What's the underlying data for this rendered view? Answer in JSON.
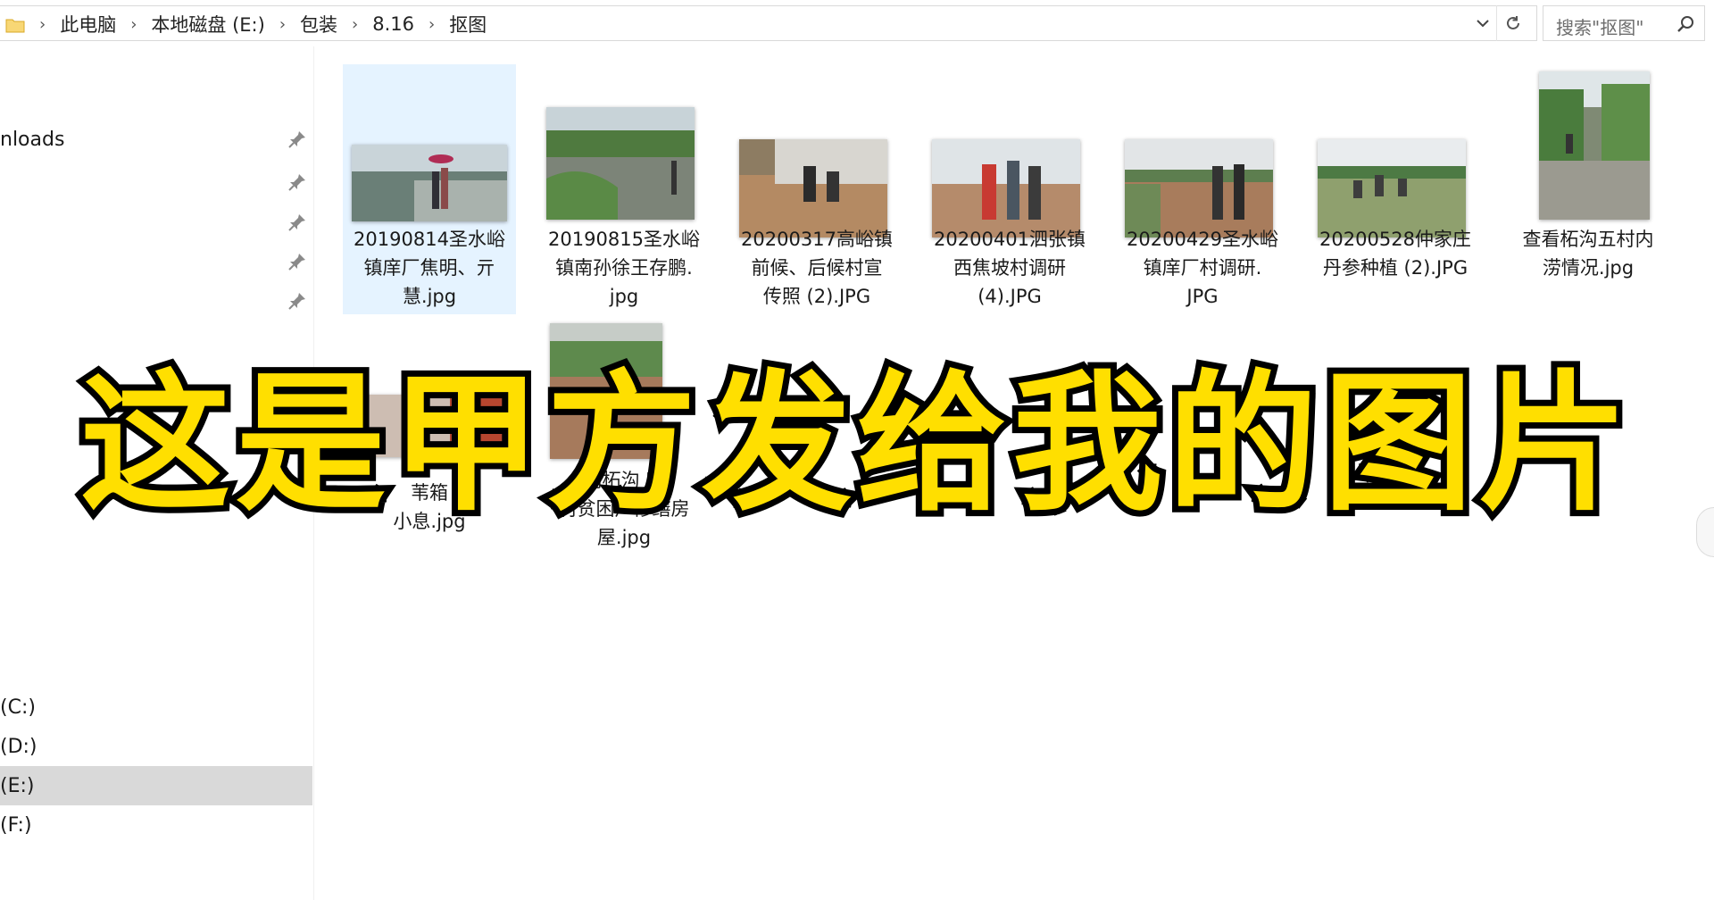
{
  "address_bar": {
    "breadcrumbs": [
      "此电脑",
      "本地磁盘 (E:)",
      "包装",
      "8.16",
      "抠图"
    ],
    "search_placeholder": "搜索\"抠图\""
  },
  "nav": {
    "quick_access_item": "nloads",
    "drives": [
      "(C:)",
      "(D:)",
      "(E:)",
      "(F:)"
    ],
    "selected_drive_index": 2
  },
  "files": [
    {
      "name": "20190814圣水峪镇庠厂焦明、亓慧.jpg",
      "line1": "20190814圣水峪",
      "line2": "镇庠厂焦明、亓",
      "line3": "慧.jpg",
      "selected": true
    },
    {
      "name": "20190815圣水峪镇南孙徐王存鹏.jpg",
      "line1": "20190815圣水峪",
      "line2": "镇南孙徐王存鹏.",
      "line3": "jpg"
    },
    {
      "name": "20200317高峪镇前候、后候村宣传照 (2).JPG",
      "line1": "20200317高峪镇",
      "line2": "前候、后候村宣",
      "line3": "传照 (2).JPG"
    },
    {
      "name": "20200401泗张镇西焦坡村调研 (4).JPG",
      "line1": "20200401泗张镇",
      "line2": "西焦坡村调研",
      "line3": "(4).JPG"
    },
    {
      "name": "20200429圣水峪镇庠厂村调研.JPG",
      "line1": "20200429圣水峪",
      "line2": "镇庠厂村调研.",
      "line3": "JPG"
    },
    {
      "name": "20200528仲家庄丹参种植 (2).JPG",
      "line1": "20200528仲家庄",
      "line2": "丹参种植 (2).JPG",
      "line3": ""
    },
    {
      "name": "查看柘沟五村内涝情况.jpg",
      "line1": "查看柘沟五村内",
      "line2": "涝情况.jpg",
      "line3": ""
    },
    {
      "name": "partial-8",
      "line1": "",
      "line2": "苇箱",
      "line3": "小息.jpg"
    },
    {
      "name": "partial-9",
      "line1": "",
      "line2": "内柘沟  家",
      "line3": "村贫困户修缮房",
      "line4": "屋.jpg"
    }
  ],
  "overlay_caption": "这是甲方发给我的图片",
  "colors": {
    "caption_fill": "#ffdf00",
    "caption_stroke": "#000000",
    "selection_bg": "#e5f3ff",
    "drive_selected_bg": "#d9d9d9"
  }
}
